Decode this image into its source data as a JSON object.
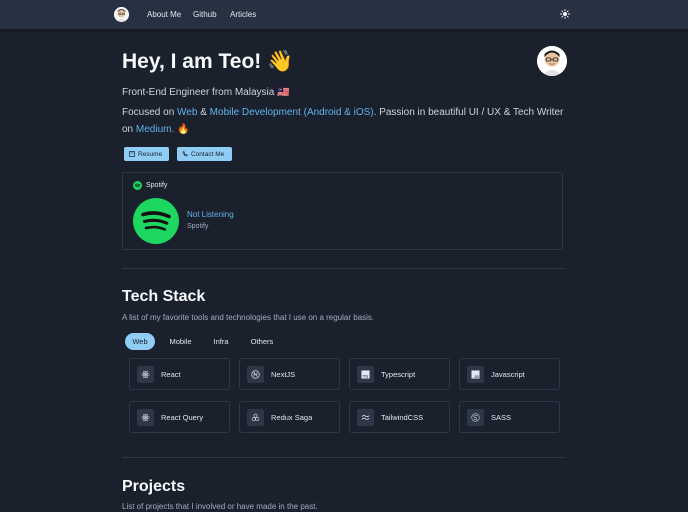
{
  "nav": {
    "items": [
      "About Me",
      "Github",
      "Articles"
    ]
  },
  "hero": {
    "title": "Hey, I am Teo! 👋",
    "subtitle": "Front-End Engineer from Malaysia 🇲🇾",
    "desc_prefix": "Focused on ",
    "desc_web": "Web",
    "desc_amp": " & ",
    "desc_mobile": "Mobile Development (Android & iOS)",
    "desc_mid": ". Passion in beautiful UI / UX & Tech Writer on ",
    "desc_medium": "Medium.",
    "desc_suffix": " 🔥"
  },
  "buttons": {
    "resume": "Resume",
    "contact": "Contact Me"
  },
  "spotify": {
    "header": "Spotify",
    "status": "Not Listening",
    "source": "Spotify"
  },
  "tech": {
    "title": "Tech Stack",
    "description": "A list of my favorite tools and technologies that I use on a regular basis.",
    "tabs": [
      "Web",
      "Mobile",
      "Infra",
      "Others"
    ],
    "active_tab": "Web",
    "items": [
      {
        "label": "React",
        "icon": "react-icon"
      },
      {
        "label": "NextJS",
        "icon": "nextjs-icon"
      },
      {
        "label": "Typescript",
        "icon": "typescript-icon"
      },
      {
        "label": "Javascript",
        "icon": "javascript-icon"
      },
      {
        "label": "React Query",
        "icon": "react-query-icon"
      },
      {
        "label": "Redux Saga",
        "icon": "redux-saga-icon"
      },
      {
        "label": "TailwindCSS",
        "icon": "tailwind-icon"
      },
      {
        "label": "SASS",
        "icon": "sass-icon"
      }
    ]
  },
  "projects": {
    "title": "Projects",
    "description": "List of projects that I involved or have made in the past."
  },
  "colors": {
    "background": "#1a202c",
    "navbar": "#283142",
    "accent": "#90cdf4",
    "link": "#63b3ed",
    "spotify_green": "#1ed760"
  }
}
